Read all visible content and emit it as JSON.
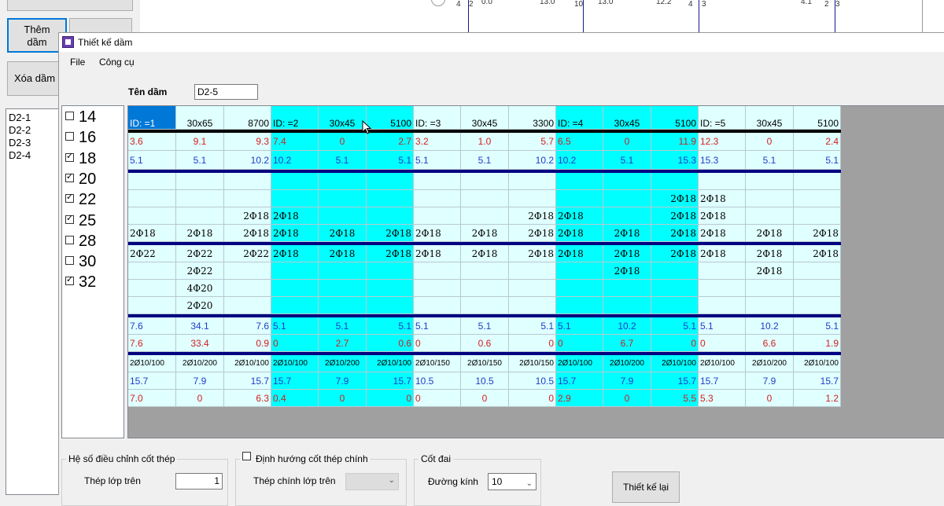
{
  "background": {
    "buttons": {
      "them": "Thêm\ndầm",
      "xoa": "Xóa dầm"
    },
    "beam_list": [
      "D2-1",
      "D2-2",
      "D2-3",
      "D2-4"
    ],
    "top_labels": [
      "4",
      "2",
      "0.0",
      "13.0",
      "10",
      "13.0",
      "12.2",
      "4",
      "3",
      "4.1",
      "2",
      "3"
    ]
  },
  "dialog": {
    "title": "Thiết kế dầm",
    "menu": [
      "File",
      "Công cụ"
    ],
    "ten_dam_label": "Tên dầm",
    "ten_dam_value": "D2-5",
    "diameters": [
      {
        "label": "14",
        "checked": false
      },
      {
        "label": "16",
        "checked": false
      },
      {
        "label": "18",
        "checked": true
      },
      {
        "label": "20",
        "checked": true
      },
      {
        "label": "22",
        "checked": true
      },
      {
        "label": "25",
        "checked": true
      },
      {
        "label": "28",
        "checked": false
      },
      {
        "label": "30",
        "checked": false
      },
      {
        "label": "32",
        "checked": true
      }
    ],
    "grid": {
      "rows": [
        [
          "ID: =1",
          "30x65",
          "8700",
          "ID: =2",
          "30x45",
          "5100",
          "ID: =3",
          "30x45",
          "3300",
          "ID: =4",
          "30x45",
          "5100",
          "ID: =5",
          "30x45",
          "5100"
        ],
        [
          "3.6",
          "9.1",
          "9.3",
          "7.4",
          "0",
          "2.7",
          "3.2",
          "1.0",
          "5.7",
          "6.5",
          "0",
          "11.9",
          "12.3",
          "0",
          "2.4"
        ],
        [
          "5.1",
          "5.1",
          "10.2",
          "10.2",
          "5.1",
          "5.1",
          "5.1",
          "5.1",
          "10.2",
          "10.2",
          "5.1",
          "15.3",
          "15.3",
          "5.1",
          "5.1"
        ],
        [
          "",
          "",
          "",
          "",
          "",
          "",
          "",
          "",
          "",
          "",
          "",
          "",
          "",
          "",
          ""
        ],
        [
          "",
          "",
          "",
          "",
          "",
          "",
          "",
          "",
          "",
          "",
          "",
          "2Φ18",
          "2Φ18",
          "",
          ""
        ],
        [
          "",
          "",
          "2Φ18",
          "2Φ18",
          "",
          "",
          "",
          "",
          "2Φ18",
          "2Φ18",
          "",
          "2Φ18",
          "2Φ18",
          "",
          ""
        ],
        [
          "2Φ18",
          "2Φ18",
          "2Φ18",
          "2Φ18",
          "2Φ18",
          "2Φ18",
          "2Φ18",
          "2Φ18",
          "2Φ18",
          "2Φ18",
          "2Φ18",
          "2Φ18",
          "2Φ18",
          "2Φ18",
          "2Φ18"
        ],
        [
          "2Φ22",
          "2Φ22",
          "2Φ22",
          "2Φ18",
          "2Φ18",
          "2Φ18",
          "2Φ18",
          "2Φ18",
          "2Φ18",
          "2Φ18",
          "2Φ18",
          "2Φ18",
          "2Φ18",
          "2Φ18",
          "2Φ18"
        ],
        [
          "",
          "2Φ22",
          "",
          "",
          "",
          "",
          "",
          "",
          "",
          "",
          "2Φ18",
          "",
          "",
          "2Φ18",
          ""
        ],
        [
          "",
          "4Φ20",
          "",
          "",
          "",
          "",
          "",
          "",
          "",
          "",
          "",
          "",
          "",
          "",
          ""
        ],
        [
          "",
          "2Φ20",
          "",
          "",
          "",
          "",
          "",
          "",
          "",
          "",
          "",
          "",
          "",
          "",
          ""
        ],
        [
          "7.6",
          "34.1",
          "7.6",
          "5.1",
          "5.1",
          "5.1",
          "5.1",
          "5.1",
          "5.1",
          "5.1",
          "10.2",
          "5.1",
          "5.1",
          "10.2",
          "5.1"
        ],
        [
          "7.6",
          "33.4",
          "0.9",
          "0",
          "2.7",
          "0.6",
          "0",
          "0.6",
          "0",
          "0",
          "6.7",
          "0",
          "0",
          "6.6",
          "1.9"
        ],
        [
          "2Ø10/100",
          "2Ø10/200",
          "2Ø10/100",
          "2Ø10/100",
          "2Ø10/200",
          "2Ø10/100",
          "2Ø10/150",
          "2Ø10/150",
          "2Ø10/150",
          "2Ø10/100",
          "2Ø10/200",
          "2Ø10/100",
          "2Ø10/100",
          "2Ø10/200",
          "2Ø10/100"
        ],
        [
          "15.7",
          "7.9",
          "15.7",
          "15.7",
          "7.9",
          "15.7",
          "10.5",
          "10.5",
          "10.5",
          "15.7",
          "7.9",
          "15.7",
          "15.7",
          "7.9",
          "15.7"
        ],
        [
          "7.0",
          "0",
          "6.3",
          "0.4",
          "0",
          "0",
          "0",
          "0",
          "0",
          "2.9",
          "0",
          "5.5",
          "5.3",
          "0",
          "1.2"
        ]
      ],
      "colors": {
        "cyan": "#00ffff",
        "light": "#e0ffff",
        "selected": "#0078d7",
        "red_text": "#d42020",
        "blue_text": "#1f3cc8",
        "separator": "#000080"
      }
    },
    "group1": {
      "title": "Hệ số điều chỉnh cốt thép",
      "label": "Thép lớp trên",
      "value": "1"
    },
    "group2": {
      "title": "Định hướng cốt thép chính",
      "label": "Thép chính lớp trên"
    },
    "group3": {
      "title": "Cốt đai",
      "label": "Đường kính",
      "value": "10"
    },
    "button_label": "Thiết kế lại"
  }
}
